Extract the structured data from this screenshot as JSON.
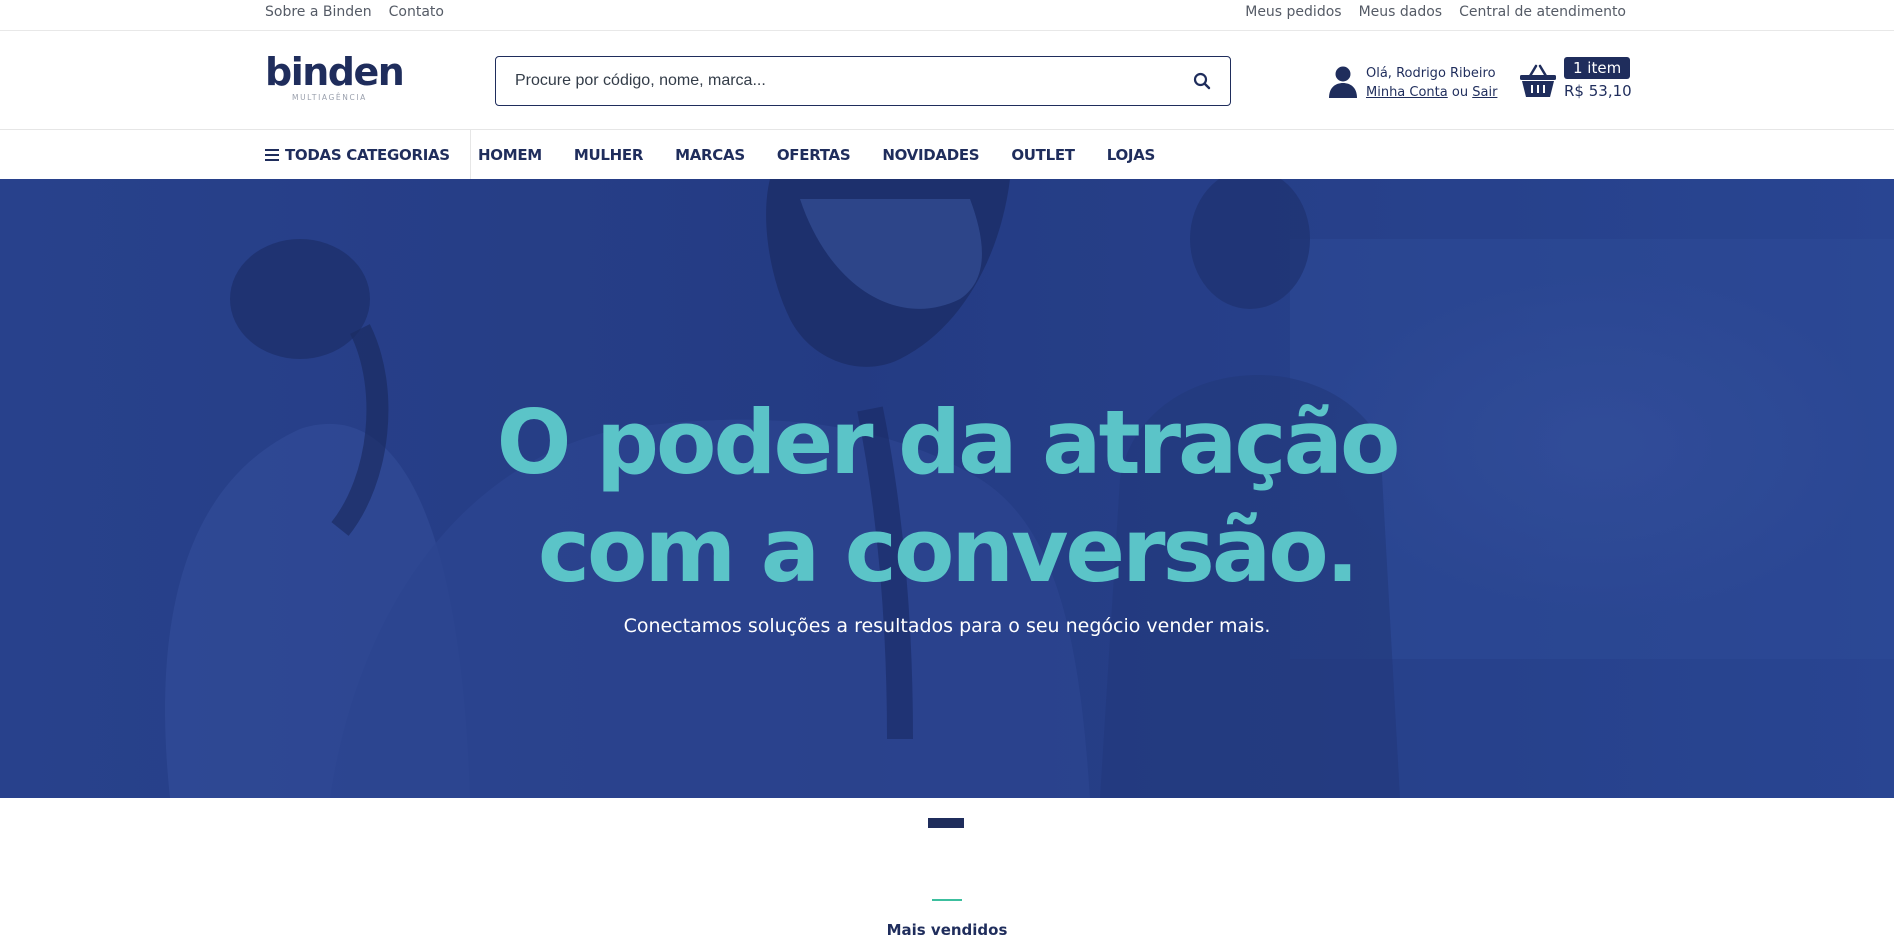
{
  "topbar": {
    "left_links": [
      "Sobre a Binden",
      "Contato"
    ],
    "right_links": [
      "Meus pedidos",
      "Meus dados",
      "Central de atendimento"
    ]
  },
  "brand": {
    "name": "binden",
    "tagline": "MULTIAGÊNCIA",
    "primary_color": "#1f2d5c",
    "accent_color": "#5bc4c8"
  },
  "search": {
    "placeholder": "Procure por código, nome, marca...",
    "icon": "search-icon"
  },
  "user": {
    "greeting": "Olá, Rodrigo Ribeiro",
    "account_link": "Minha Conta",
    "separator": "ou",
    "logout_link": "Sair",
    "icon": "user-icon"
  },
  "cart": {
    "count_label": "1 item",
    "total": "R$ 53,10",
    "icon": "basket-icon"
  },
  "nav": {
    "all_categories": "TODAS CATEGORIAS",
    "items": [
      "HOMEM",
      "MULHER",
      "MARCAS",
      "OFERTAS",
      "NOVIDADES",
      "OUTLET",
      "LOJAS"
    ]
  },
  "hero": {
    "title_line1": "O poder da atração",
    "title_line2": "com a conversão.",
    "subtitle": "Conectamos soluções a resultados para o seu negócio vender mais.",
    "slides_total": 1,
    "active_slide": 1
  },
  "section": {
    "title": "Mais vendidos"
  }
}
